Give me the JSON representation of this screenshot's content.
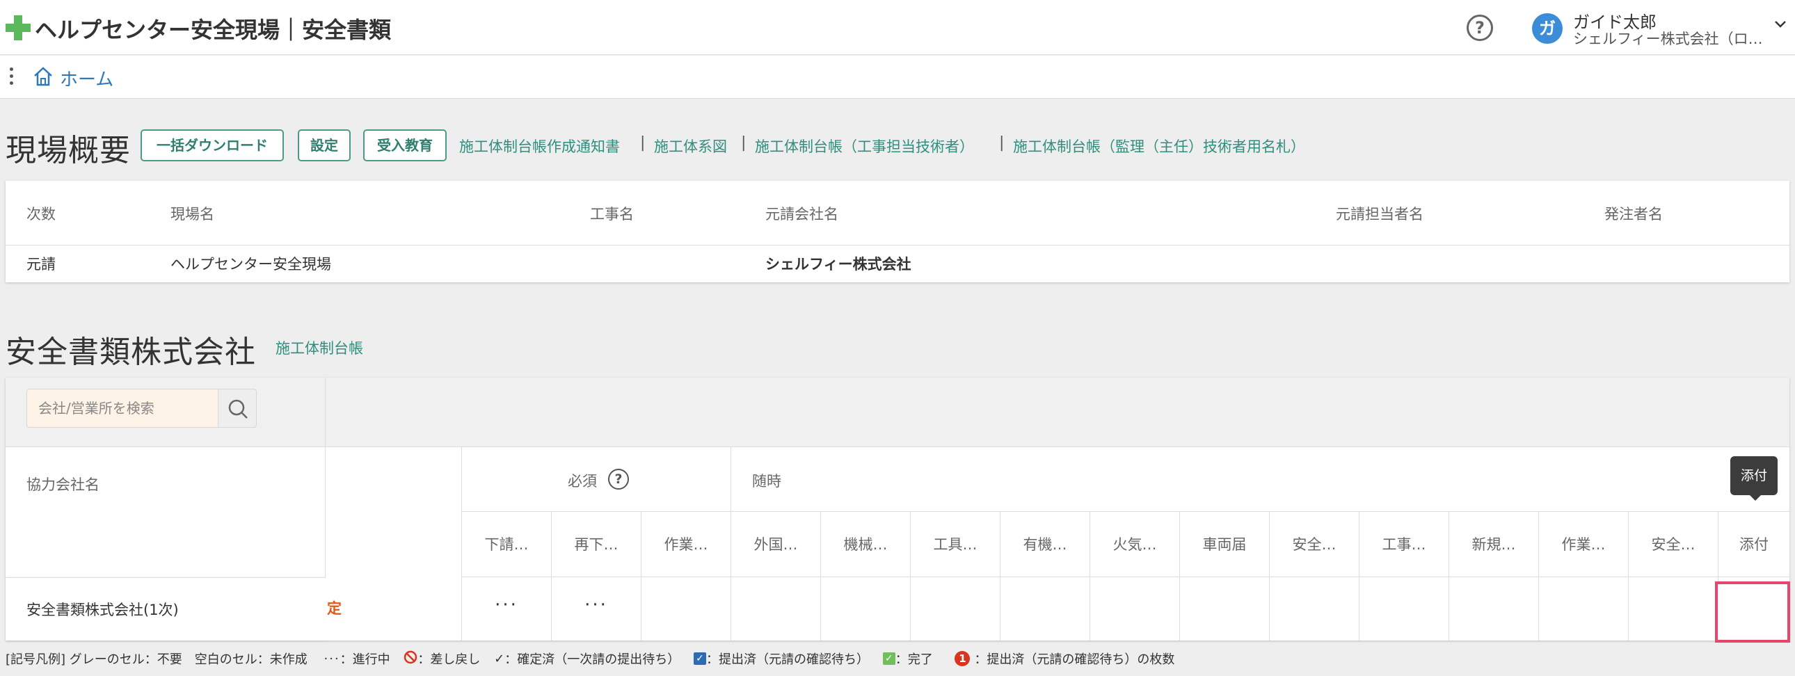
{
  "header": {
    "title": "ヘルプセンター安全現場｜安全書類",
    "help_icon_glyph": "?",
    "avatar_initial": "ガ",
    "user_name": "ガイド太郎",
    "user_company": "シェルフィー株式会社（ロ…"
  },
  "subbar": {
    "home_label": "ホーム"
  },
  "overview": {
    "title": "現場概要",
    "buttons": [
      "一括ダウンロード",
      "設定",
      "受入教育"
    ],
    "links": [
      "施工体制台帳作成通知書",
      "施工体系図",
      "施工体制台帳（工事担当技術者）",
      "施工体制台帳（監理（主任）技術者用名札）"
    ],
    "separator": "|",
    "columns": [
      "次数",
      "現場名",
      "工事名",
      "元請会社名",
      "元請担当者名",
      "発注者名"
    ],
    "row": {
      "tier": "元請",
      "site_name": "ヘルプセンター安全現場",
      "project_name": "",
      "contractor_name": "シェルフィー株式会社",
      "contact_name": "",
      "client_name": ""
    }
  },
  "company_section": {
    "title": "安全書類株式会社",
    "link": "施工体制台帳",
    "search_placeholder": "会社/営業所を検索",
    "col_company_label": "協力会社名",
    "company_name": "安全書類株式会社(1次)",
    "status_fragment": "定",
    "groups": {
      "required": "必須",
      "required_help_glyph": "?",
      "optional": "随時"
    },
    "sub_columns": [
      "下請…",
      "再下…",
      "作業…",
      "外国…",
      "機械…",
      "工具…",
      "有機…",
      "火気…",
      "車両届",
      "安全…",
      "工事…",
      "新規…",
      "作業…",
      "安全…",
      "添付"
    ],
    "data_cells": [
      "···",
      "···",
      "",
      "",
      "",
      "",
      "",
      "",
      "",
      "",
      "",
      "",
      "",
      "",
      ""
    ],
    "tooltip": "添付"
  },
  "legend": {
    "prefix": "[記号凡例] グレーのセル：不要　空白のセル：未作成",
    "in_progress_glyph": "···",
    "in_progress": "：進行中",
    "rejected_glyph": "⃠",
    "rejected": "：差し戻し",
    "confirmed_glyph": "✓",
    "confirmed": "：確定済（一次請の提出待ち）",
    "submitted_glyph": "✓",
    "submitted": "：提出済（元請の確認待ち）",
    "complete_glyph": "✓",
    "complete": "：完了",
    "count_glyph": "1",
    "count": "：提出済（元請の確認待ち）の枚数"
  },
  "colors": {
    "brand_green": "#5cb85c",
    "link_teal": "#2f8f7f",
    "link_blue": "#2b79b8",
    "highlight_pink": "#e8456c",
    "status_orange": "#e05a1a"
  }
}
